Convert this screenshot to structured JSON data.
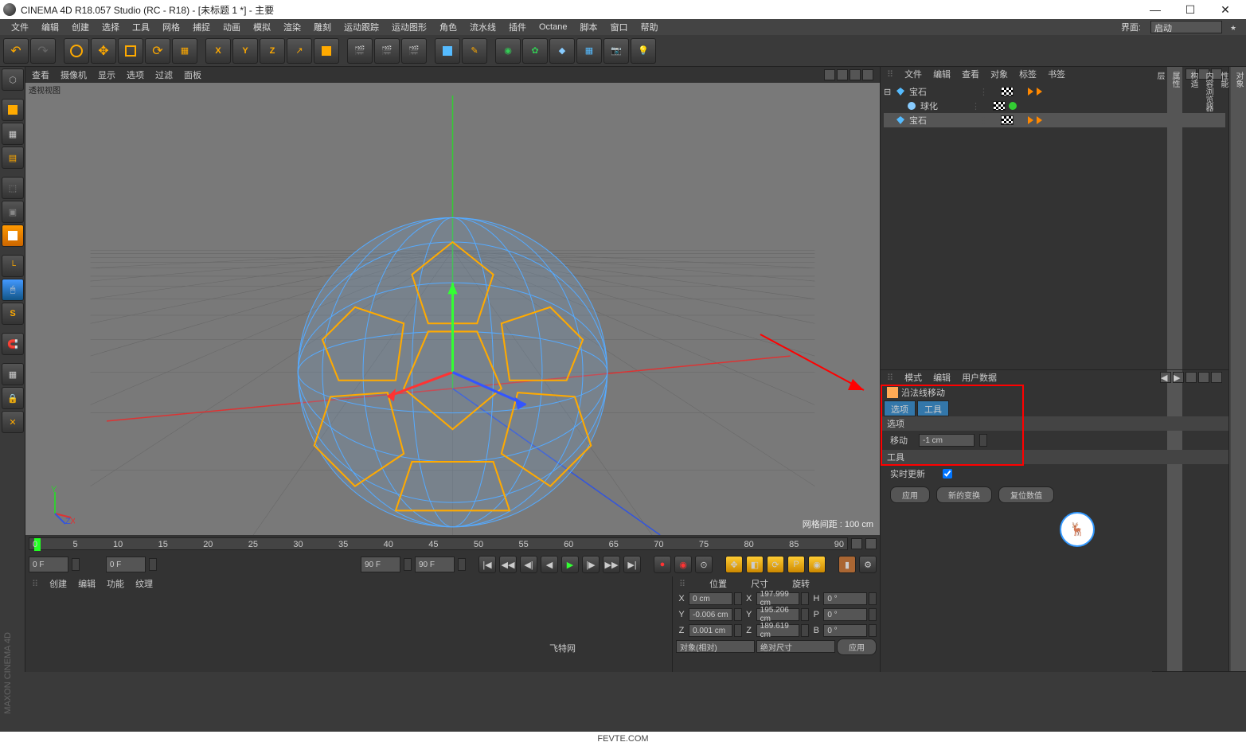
{
  "window": {
    "title": "CINEMA 4D R18.057 Studio (RC - R18) - [未标题 1 *] - 主要"
  },
  "menubar": {
    "items": [
      "文件",
      "编辑",
      "创建",
      "选择",
      "工具",
      "网格",
      "捕捉",
      "动画",
      "模拟",
      "渲染",
      "雕刻",
      "运动跟踪",
      "运动图形",
      "角色",
      "流水线",
      "插件",
      "Octane",
      "脚本",
      "窗口",
      "帮助"
    ],
    "layout_label": "界面:",
    "layout_value": "启动"
  },
  "viewport": {
    "tabs": [
      "查看",
      "摄像机",
      "显示",
      "选项",
      "过滤",
      "面板"
    ],
    "mode": "透视视图",
    "grid_info": "网格间距 : 100 cm",
    "axes": {
      "x": "X",
      "y": "Y",
      "z": "Z"
    }
  },
  "timeline": {
    "ticks": [
      "0",
      "5",
      "10",
      "15",
      "20",
      "25",
      "30",
      "35",
      "40",
      "45",
      "50",
      "55",
      "60",
      "65",
      "70",
      "75",
      "80",
      "85",
      "90"
    ],
    "start": "0 F",
    "end": "90 F",
    "from": "0 F",
    "to": "90 F"
  },
  "bottom_tabs": [
    "创建",
    "编辑",
    "功能",
    "纹理"
  ],
  "coords": {
    "headers": [
      "位置",
      "尺寸",
      "旋转"
    ],
    "rows": [
      {
        "axis": "X",
        "pos": "0 cm",
        "size": "197.999 cm",
        "rotlab": "H",
        "rot": "0 °"
      },
      {
        "axis": "Y",
        "pos": "-0.006 cm",
        "size": "195.206 cm",
        "rotlab": "P",
        "rot": "0 °"
      },
      {
        "axis": "Z",
        "pos": "0.001 cm",
        "size": "189.619 cm",
        "rotlab": "B",
        "rot": "0 °"
      }
    ],
    "mode1": "对象(相对)",
    "mode2": "绝对尺寸",
    "apply": "应用"
  },
  "obj_panel": {
    "tabs": [
      "文件",
      "编辑",
      "查看",
      "对象",
      "标签",
      "书签"
    ],
    "tree": [
      {
        "name": "宝石",
        "indent": 0,
        "icon": "gem",
        "sel": false
      },
      {
        "name": "球化",
        "indent": 1,
        "icon": "sphere",
        "sel": false
      },
      {
        "name": "宝石",
        "indent": 0,
        "icon": "gem",
        "sel": true
      }
    ]
  },
  "attr_panel": {
    "tabs": [
      "模式",
      "编辑",
      "用户数据"
    ],
    "title": "沿法线移动",
    "subtabs": [
      "选项",
      "工具"
    ],
    "section1": "选项",
    "move_label": "移动",
    "move_value": "-1 cm",
    "section2": "工具",
    "realtime_label": "实时更新",
    "buttons": [
      "应用",
      "新的变换",
      "复位数值"
    ]
  },
  "right_side_tabs": [
    "对象",
    "性能",
    "内容浏览器",
    "构造",
    "属性",
    "层"
  ],
  "brand": "MAXON CINEMA 4D",
  "footer": "FEVTE.COM",
  "wm_inner": "飞特网"
}
